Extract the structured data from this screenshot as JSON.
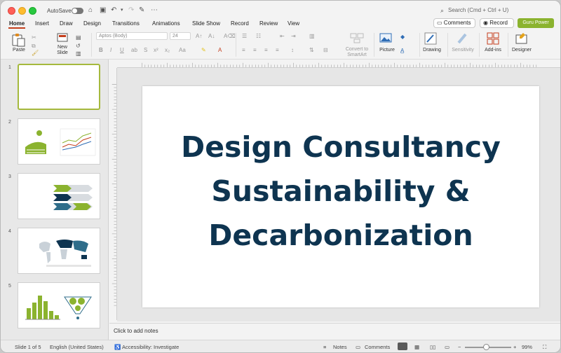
{
  "titlebar": {
    "autosave_label": "AutoSave",
    "search_placeholder": "Search (Cmd + Ctrl + U)"
  },
  "tabs": [
    "Home",
    "Insert",
    "Draw",
    "Design",
    "Transitions",
    "Animations",
    "Slide Show",
    "Record",
    "Review",
    "View"
  ],
  "header_buttons": {
    "comments": "Comments",
    "record": "Record",
    "guru": "Guru Power"
  },
  "ribbon": {
    "paste": "Paste",
    "new_slide": "New Slide",
    "font_name": "Aptos (Body)",
    "font_size": "24",
    "convert_smartart": "Convert to SmartArt",
    "picture": "Picture",
    "drawing": "Drawing",
    "sensitivity": "Sensitivity",
    "addins": "Add-ins",
    "designer": "Designer"
  },
  "thumbnails": [
    {
      "number": "1",
      "selected": true
    },
    {
      "number": "2",
      "selected": false
    },
    {
      "number": "3",
      "selected": false
    },
    {
      "number": "4",
      "selected": false
    },
    {
      "number": "5",
      "selected": false
    }
  ],
  "slide": {
    "title_line1": "Design Consultancy",
    "title_line2": "Sustainability &",
    "title_line3": "Decarbonization",
    "title_color": "#0e3450"
  },
  "notes_placeholder": "Click to add notes",
  "statusbar": {
    "slide_info": "Slide 1 of 5",
    "language": "English (United States)",
    "accessibility": "Accessibility: Investigate",
    "notes": "Notes",
    "comments": "Comments",
    "zoom": "99%"
  },
  "colors": {
    "accent": "#c43e1c",
    "brand_green": "#8bb32f",
    "selection": "#a5b93d"
  }
}
